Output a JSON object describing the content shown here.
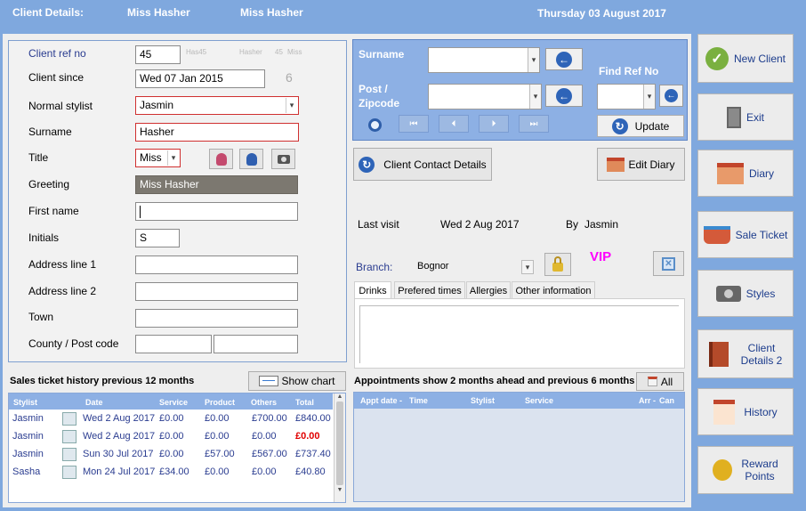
{
  "header": {
    "label": "Client Details:",
    "name1": "Miss Hasher",
    "name2": "Miss Hasher",
    "date": "Thursday 03 August 2017"
  },
  "form": {
    "client_ref_label": "Client ref no",
    "client_ref_value": "45",
    "ghost1": "Has45",
    "ghost2": "Hasher",
    "ghost3": "45",
    "ghost4": "Miss",
    "client_since_label": "Client since",
    "client_since_value": "Wed 07 Jan 2015",
    "client_since_count": "6",
    "normal_stylist_label": "Normal stylist",
    "normal_stylist_value": "Jasmin",
    "surname_label": "Surname",
    "surname_value": "Hasher",
    "title_label": "Title",
    "title_value": "Miss",
    "greeting_label": "Greeting",
    "greeting_value": "Miss Hasher",
    "first_name_label": "First name",
    "first_name_value": "",
    "initials_label": "Initials",
    "initials_value": "S",
    "address1_label": "Address line 1",
    "address2_label": "Address line 2",
    "town_label": "Town",
    "county_label": "County / Post code"
  },
  "search": {
    "surname_label": "Surname",
    "post_label_1": "Post /",
    "post_label_2": "Zipcode",
    "find_ref_label": "Find Ref No",
    "update_label": "Update"
  },
  "actions": {
    "contact_details": "Client Contact Details",
    "edit_diary": "Edit Diary"
  },
  "visit": {
    "last_visit_label": "Last visit",
    "last_visit_value": "Wed 2 Aug 2017",
    "by_label": "By",
    "by_value": "Jasmin"
  },
  "branch": {
    "label": "Branch:",
    "value": "Bognor",
    "vip": "VIP"
  },
  "tabs": [
    "Drinks",
    "Prefered times",
    "Allergies",
    "Other information"
  ],
  "sales": {
    "title": "Sales ticket history previous 12 months",
    "show_chart": "Show chart",
    "columns": [
      "Stylist",
      "Date",
      "Service",
      "Product",
      "Others",
      "Total"
    ],
    "rows": [
      {
        "stylist": "Jasmin",
        "date": "Wed 2 Aug 2017",
        "service": "£0.00",
        "product": "£0.00",
        "others": "£700.00",
        "total": "£840.00"
      },
      {
        "stylist": "Jasmin",
        "date": "Wed 2 Aug 2017",
        "service": "£0.00",
        "product": "£0.00",
        "others": "£0.00",
        "total": "£0.00"
      },
      {
        "stylist": "Jasmin",
        "date": "Sun 30 Jul 2017",
        "service": "£0.00",
        "product": "£57.00",
        "others": "£567.00",
        "total": "£737.40"
      },
      {
        "stylist": "Sasha",
        "date": "Mon 24 Jul 2017",
        "service": "£34.00",
        "product": "£0.00",
        "others": "£0.00",
        "total": "£40.80"
      }
    ]
  },
  "appointments": {
    "title": "Appointments show 2 months ahead and previous 6 months",
    "all_label": "All",
    "columns": [
      "Appt date -",
      "Time",
      "Stylist",
      "Service",
      "Arr -",
      "Can"
    ]
  },
  "sidebar": {
    "new_client": "New Client",
    "exit": "Exit",
    "diary": "Diary",
    "sale_ticket": "Sale Ticket",
    "styles": "Styles",
    "client_details_2a": "Client",
    "client_details_2b": "Details 2",
    "history": "History",
    "reward_a": "Reward",
    "reward_b": "Points"
  },
  "colors": {
    "header_bg": "#7fa8de",
    "panel_bg": "#eeeeee",
    "accent": "#2e64b8",
    "alert_red": "#e00000",
    "vip": "#ff00ff"
  }
}
